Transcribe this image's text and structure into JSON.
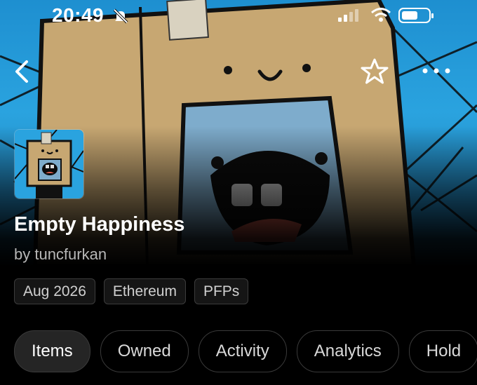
{
  "status_bar": {
    "time": "20:49",
    "icons": [
      "bell-slash-icon",
      "cellular-signal-icon",
      "wifi-icon",
      "battery-icon"
    ]
  },
  "nav": {
    "icons": [
      "back-chevron-icon",
      "star-outline-icon",
      "more-dots-icon"
    ]
  },
  "collection": {
    "name": "Empty Happiness",
    "creator": "by tuncfurkan",
    "tags": [
      "Aug 2026",
      "Ethereum",
      "PFPs"
    ]
  },
  "tabs": [
    {
      "label": "Items",
      "active": true
    },
    {
      "label": "Owned",
      "active": false
    },
    {
      "label": "Activity",
      "active": false
    },
    {
      "label": "Analytics",
      "active": false
    },
    {
      "label": "Hold",
      "active": false
    }
  ],
  "colors": {
    "background": "#000000",
    "hero_sky": "#2aa3df",
    "box": "#c7a772",
    "tab_active_bg": "#252525",
    "tag_border": "#3c3c3c"
  }
}
